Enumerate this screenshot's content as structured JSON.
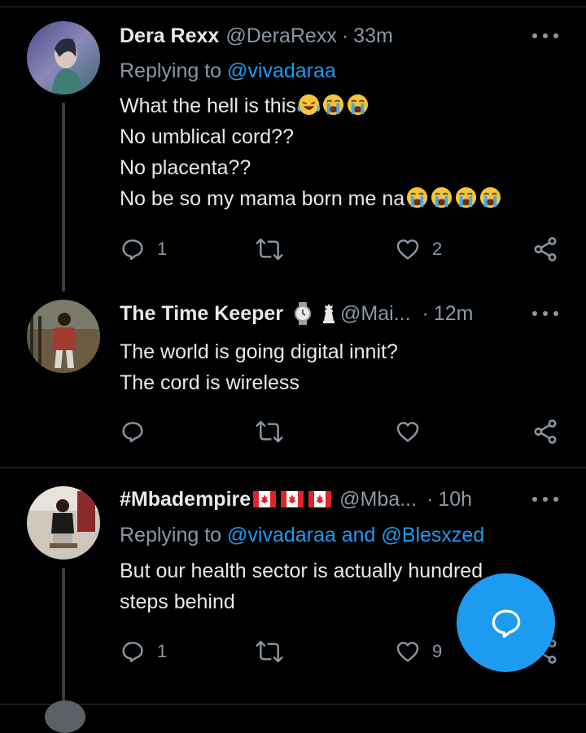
{
  "tweets": [
    {
      "name": "Dera Rexx",
      "handle": "@DeraRexx",
      "dot": "·",
      "time": "33m",
      "replying_prefix": "Replying to",
      "replying_mentions": "@vivadaraa",
      "lines": [
        "What the hell is this",
        "No umblical cord??",
        "No placenta??",
        "No be so my mama born me na"
      ],
      "reply_count": "1",
      "like_count": "2"
    },
    {
      "name": "The Time Keeper",
      "handle": "@Mai...",
      "dot": "·",
      "time": "12m",
      "lines": [
        "The world is going digital innit?",
        "The cord is wireless"
      ],
      "reply_count": "",
      "like_count": ""
    },
    {
      "name": "#Mbadempire",
      "handle": "@Mba...",
      "dot": "·",
      "time": "10h",
      "replying_prefix": "Replying to",
      "replying_mentions": "@vivadaraa and @Blesxzed",
      "lines": [
        "But our health sector is actually hundred",
        "steps behind"
      ],
      "reply_count": "1",
      "like_count": "9"
    }
  ],
  "icons": {
    "reply": "reply-icon",
    "retweet": "retweet-icon",
    "like": "heart-icon",
    "share": "share-icon",
    "more": "more-icon",
    "compose": "compose-reply-icon"
  },
  "colors": {
    "background": "#000000",
    "text": "#e7e9ea",
    "secondary": "#8b98a5",
    "accent": "#1d9bf0"
  }
}
